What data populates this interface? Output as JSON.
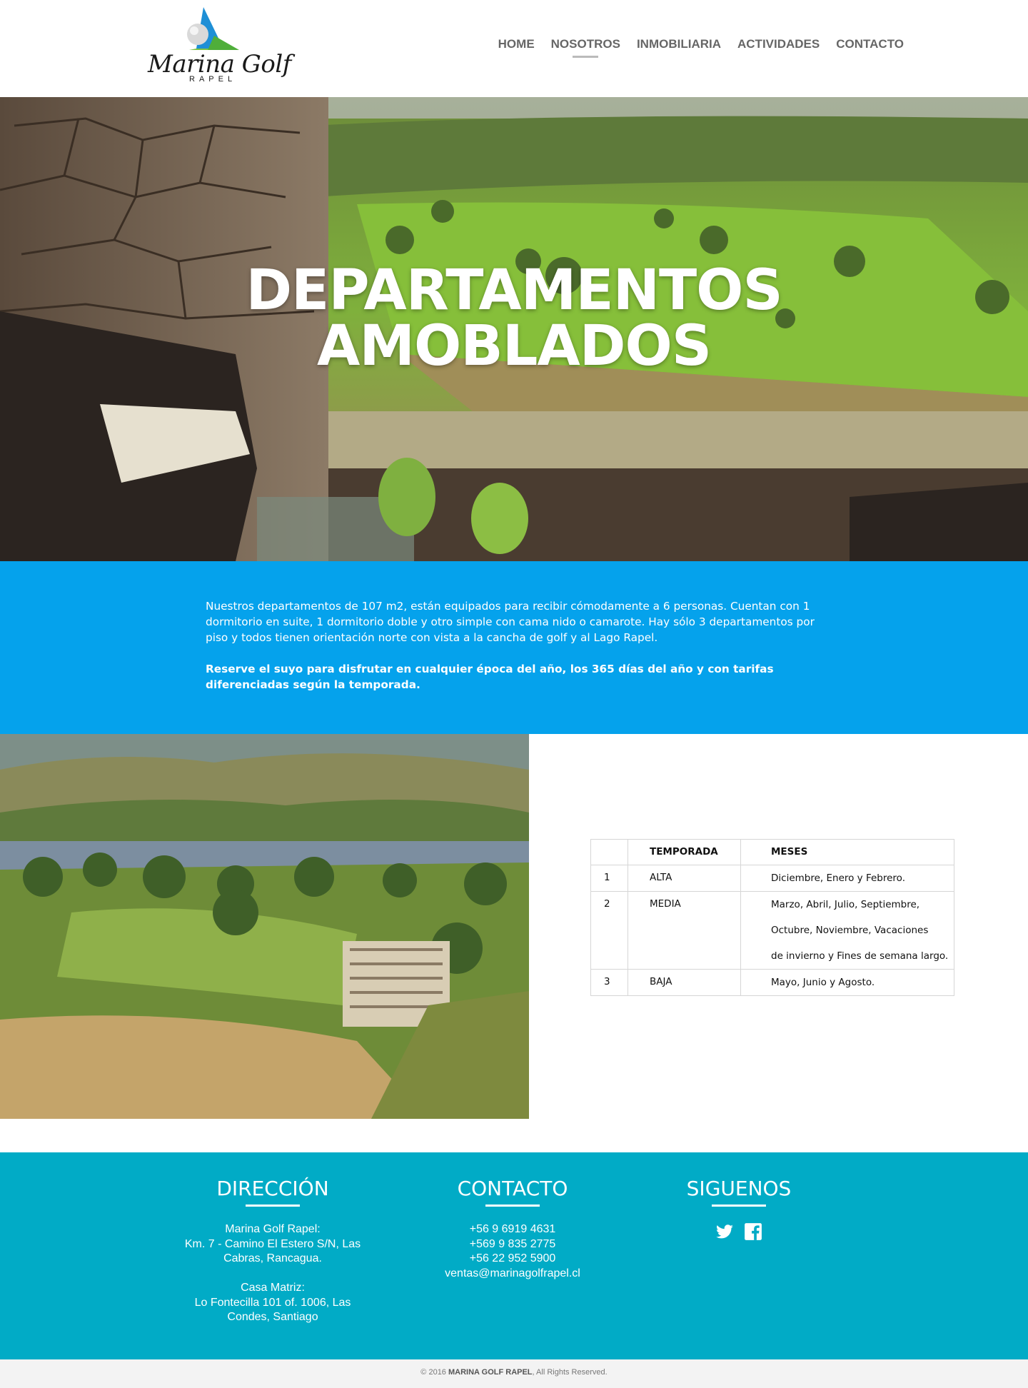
{
  "brand": {
    "name": "Marina Golf",
    "sub": "RAPEL"
  },
  "nav": {
    "items": [
      {
        "label": "HOME"
      },
      {
        "label": "NOSOTROS"
      },
      {
        "label": "INMOBILIARIA"
      },
      {
        "label": "ACTIVIDADES"
      },
      {
        "label": "CONTACTO"
      }
    ],
    "active": "NOSOTROS"
  },
  "hero": {
    "title_line1": "DEPARTAMENTOS",
    "title_line2": "AMOBLADOS"
  },
  "intro": {
    "paragraph": "Nuestros departamentos de 107 m2, están equipados para recibir cómodamente a 6 personas. Cuentan con 1 dormitorio en suite, 1 dormitorio doble y otro simple con cama nido o camarote.  Hay  sólo 3 departamentos por piso y  todos tienen orientación norte con vista a la cancha de golf y al Lago Rapel.",
    "highlight": "Reserve el suyo para disfrutar en cualquier época del año, los 365 días del año y con tarifas diferenciadas según la temporada."
  },
  "seasons": {
    "headers": [
      "",
      "TEMPORADA",
      "MESES"
    ],
    "rows": [
      {
        "num": "1",
        "season": "ALTA",
        "months": [
          "Diciembre, Enero y Febrero."
        ]
      },
      {
        "num": "2",
        "season": "MEDIA",
        "months": [
          "Marzo, Abril, Julio, Septiembre,",
          "Octubre, Noviembre, Vacaciones",
          "de invierno y Fines de semana largo."
        ]
      },
      {
        "num": "3",
        "season": "BAJA",
        "months": [
          "Mayo, Junio y Agosto."
        ]
      }
    ]
  },
  "footer": {
    "direccion": {
      "title": "DIRECCIÓN",
      "lines": [
        "Marina Golf Rapel:",
        "Km. 7 - Camino El Estero S/N, Las",
        "Cabras, Rancagua.",
        "",
        "Casa Matriz:",
        "Lo Fontecilla 101 of. 1006, Las",
        "Condes, Santiago"
      ]
    },
    "contacto": {
      "title": "CONTACTO",
      "lines": [
        "+56 9 6919 4631",
        "+569 9 835 2775",
        "+56 22 952 5900",
        "ventas@marinagolfrapel.cl"
      ]
    },
    "siguenos": {
      "title": "SIGUENOS",
      "icons": [
        "twitter-icon",
        "facebook-icon"
      ]
    }
  },
  "copyright": {
    "prefix": "© 2016 ",
    "brand": "MARINA GOLF RAPEL",
    "suffix": ", All Rights Reserved."
  },
  "colors": {
    "blue_band": "#05a2ec",
    "footer": "#01abc6",
    "nav_text": "#666666"
  }
}
